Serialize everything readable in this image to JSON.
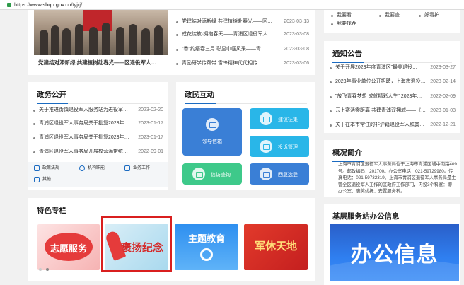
{
  "browser": {
    "url_prefix": "https://",
    "url_host": "www.shqp.gov.cn",
    "url_path": "/tyjrj/"
  },
  "top_news": {
    "photo_caption": "党建结对添新绿 共建植树赴春光——区退役军人…",
    "items": [
      {
        "title": "党建结对添新绿 共建植树赴春光——区…",
        "date": "2023-03-13"
      },
      {
        "title": "戎花绽放·拥抱春天——青浦区退役军人…",
        "date": "2023-03-08"
      },
      {
        "title": "\"香\"约缙春三月 彰显巾帼风采——青…",
        "date": "2023-03-08"
      },
      {
        "title": "青励研学传帮带 雷锋精神代代相传……",
        "date": "2023-03-06"
      }
    ]
  },
  "quick_top": {
    "links": [
      "我要看",
      "我要查",
      "好看护",
      "我要找茬"
    ]
  },
  "gov_affairs": {
    "title": "政务公开",
    "items": [
      {
        "title": "关于推进街镇退役军人服务站为进役军…",
        "date": "2023-02-20"
      },
      {
        "title": "青浦区退役军人事务局关于批复2023年…",
        "date": "2023-01-17"
      },
      {
        "title": "青浦区退役军人事务局关于批复2023年…",
        "date": "2023-01-17"
      },
      {
        "title": "青浦区退役军人事务局开展校营满带统…",
        "date": "2022-09-01"
      }
    ],
    "quick_links": [
      "政策法规",
      "机构职能",
      "业务工作",
      "其他"
    ]
  },
  "interaction": {
    "title": "政民互动",
    "tiles": {
      "mailbox": "领导信箱",
      "suggest": "建议征集",
      "complaint": "投诉管理",
      "query": "信访查询",
      "reply": "回复选登"
    }
  },
  "notices": {
    "title": "通知公告",
    "items": [
      {
        "title": "关于开展2023年度青浦区\"最美退役…",
        "date": "2023-03-27"
      },
      {
        "title": "2023年事业单位公开招聘，上海市退役…",
        "date": "2023-02-14"
      },
      {
        "title": "\"放飞青春梦想 成就精彩人生\" 2023年…",
        "date": "2022-02-09"
      },
      {
        "title": "云上赛活零距离 共建青浦双拥城——《…",
        "date": "2023-01-03"
      },
      {
        "title": "关于在本市常住的非沪籍退役军人和其…",
        "date": "2022-12-21"
      }
    ]
  },
  "overview": {
    "title": "概况简介",
    "text": "上海市青浦区退役军人事务局位于上海市青浦区城中南路409号。邮政编码：201700。办公室电话：021-59729980。传真电话：021-59732319。上海市青浦区退役军人事务局是主管全区退役军人工作的区政府工作部门，内设3个科室：即：办公室、褒奖优抚、安置服务科。"
  },
  "special": {
    "title": "特色专栏",
    "banners": [
      "志愿服务",
      "褒扬纪念",
      "主题教育",
      "军休天地"
    ]
  },
  "grassroots": {
    "title": "基层服务站办公信息",
    "banner_text": "办公信息"
  },
  "colors": {
    "accent": "#1b6bc1",
    "highlight_border": "#d91f1f",
    "tile_blue": "#3a7fd6",
    "tile_cyan": "#29b6e8",
    "tile_green": "#3ec98a"
  }
}
